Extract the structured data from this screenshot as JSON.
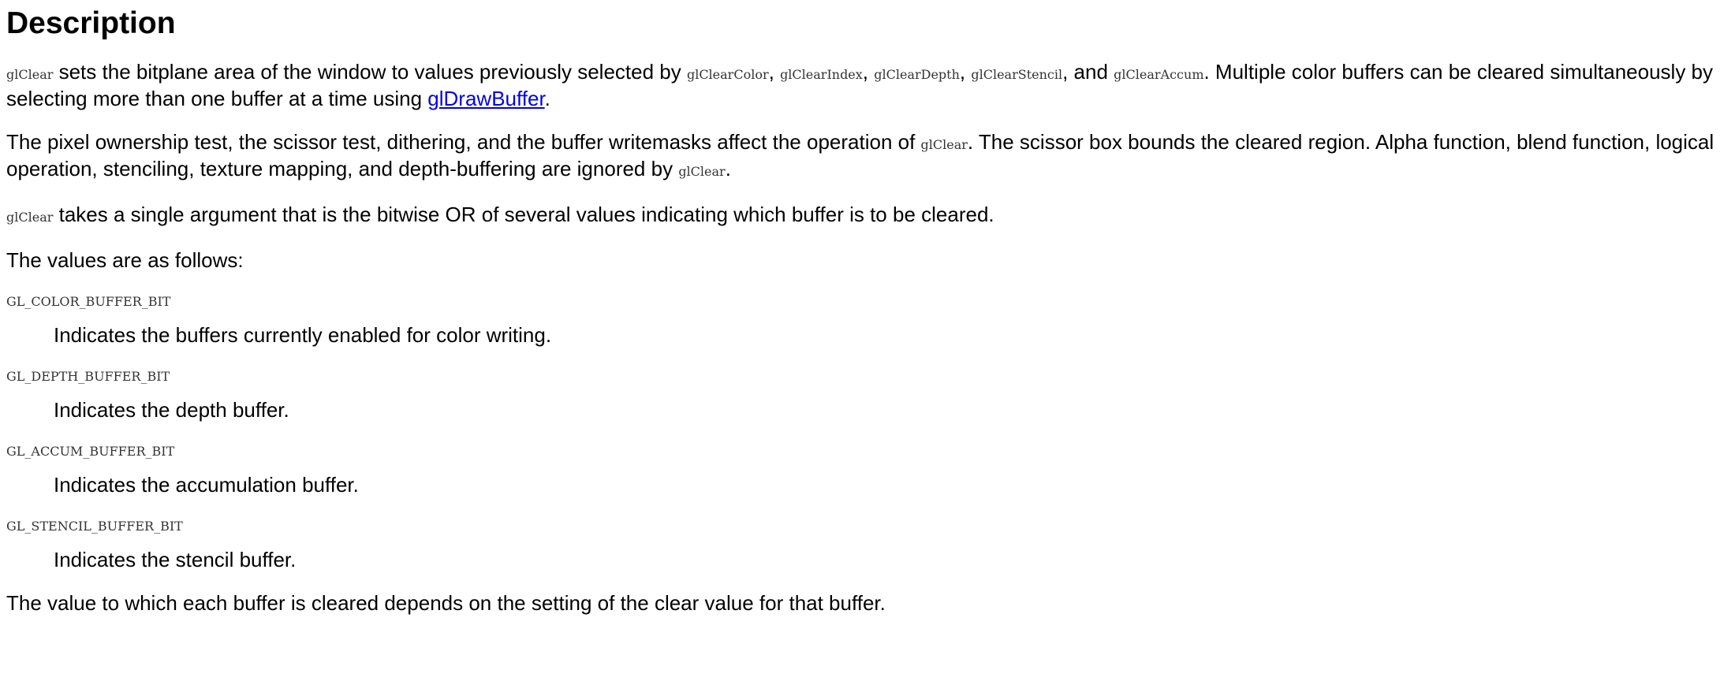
{
  "heading": "Description",
  "p1": {
    "fn": "glClear",
    "t1": " sets the bitplane area of the window to values previously selected by ",
    "c1": "glClearColor",
    "s1": ", ",
    "c2": "glClearIndex",
    "s2": ", ",
    "c3": "glClearDepth",
    "s3": ", ",
    "c4": "glClearStencil",
    "s4": ", and ",
    "c5": "glClearAccum",
    "t2": ". Multiple color buffers can be cleared simultaneously by selecting more than one buffer at a time using ",
    "link": "glDrawBuffer",
    "t3": "."
  },
  "p2": {
    "t1": "The pixel ownership test, the scissor test, dithering, and the buffer writemasks affect the operation of ",
    "c1": "glClear",
    "t2": ". The scissor box bounds the cleared region. Alpha function, blend function, logical operation, stenciling, texture mapping, and depth-buffering are ignored by ",
    "c2": "glClear",
    "t3": "."
  },
  "p3": {
    "fn": "glClear",
    "t1": " takes a single argument that is the bitwise OR of several values indicating which buffer is to be cleared."
  },
  "p4": "The values are as follows:",
  "values": [
    {
      "name": "GL_COLOR_BUFFER_BIT",
      "desc": "Indicates the buffers currently enabled for color writing."
    },
    {
      "name": "GL_DEPTH_BUFFER_BIT",
      "desc": "Indicates the depth buffer."
    },
    {
      "name": "GL_ACCUM_BUFFER_BIT",
      "desc": "Indicates the accumulation buffer."
    },
    {
      "name": "GL_STENCIL_BUFFER_BIT",
      "desc": "Indicates the stencil buffer."
    }
  ],
  "p5": "The value to which each buffer is cleared depends on the setting of the clear value for that buffer.",
  "colors": {
    "link": "#0000ee",
    "text": "#000000",
    "code": "#333333"
  }
}
